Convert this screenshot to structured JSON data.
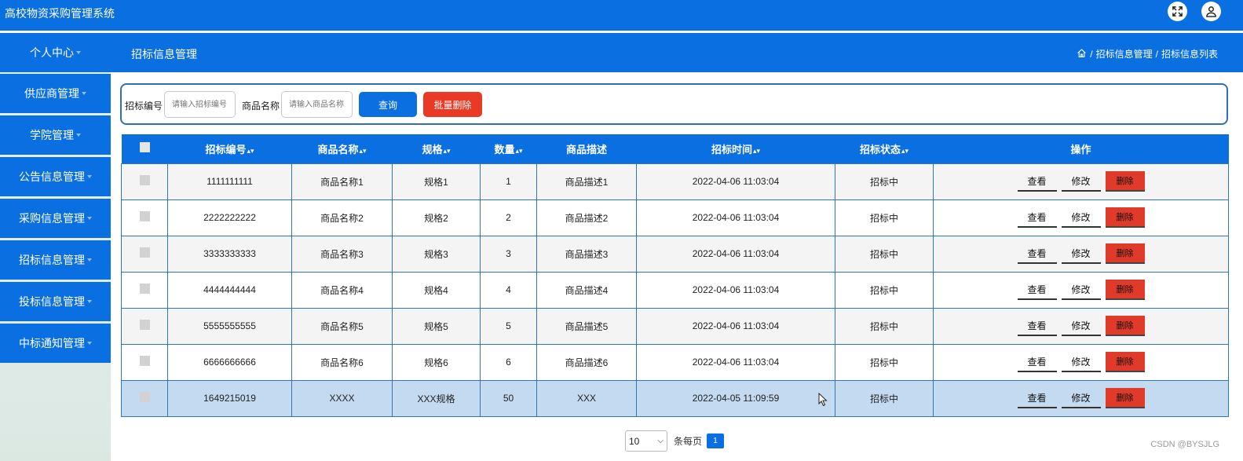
{
  "app": {
    "title": "高校物资采购管理系统"
  },
  "header": {
    "fullscreen_icon": "fullscreen-icon",
    "user_icon": "user-icon"
  },
  "sidebar": {
    "title": "个人中心",
    "items": [
      {
        "label": "供应商管理"
      },
      {
        "label": "学院管理"
      },
      {
        "label": "公告信息管理"
      },
      {
        "label": "采购信息管理"
      },
      {
        "label": "招标信息管理"
      },
      {
        "label": "投标信息管理"
      },
      {
        "label": "中标通知管理"
      }
    ]
  },
  "page": {
    "title": "招标信息管理",
    "breadcrumb": [
      "招标信息管理",
      "招标信息列表"
    ],
    "breadcrumb_sep": "/"
  },
  "search": {
    "bid_no_label": "招标编号",
    "bid_no_placeholder": "请输入招标编号",
    "product_label": "商品名称",
    "product_placeholder": "请输入商品名称",
    "query_button": "查询",
    "batch_delete_button": "批量删除"
  },
  "table": {
    "headers": [
      "招标编号",
      "商品名称",
      "规格",
      "数量",
      "商品描述",
      "招标时间",
      "招标状态",
      "操作"
    ],
    "sortable": [
      true,
      true,
      true,
      true,
      false,
      true,
      true,
      false
    ],
    "actions": {
      "view": "查看",
      "edit": "修改",
      "delete": "删除"
    },
    "rows": [
      [
        "1111111111",
        "商品名称1",
        "规格1",
        "1",
        "商品描述1",
        "2022-04-06 11:03:04",
        "招标中"
      ],
      [
        "2222222222",
        "商品名称2",
        "规格2",
        "2",
        "商品描述2",
        "2022-04-06 11:03:04",
        "招标中"
      ],
      [
        "3333333333",
        "商品名称3",
        "规格3",
        "3",
        "商品描述3",
        "2022-04-06 11:03:04",
        "招标中"
      ],
      [
        "4444444444",
        "商品名称4",
        "规格4",
        "4",
        "商品描述4",
        "2022-04-06 11:03:04",
        "招标中"
      ],
      [
        "5555555555",
        "商品名称5",
        "规格5",
        "5",
        "商品描述5",
        "2022-04-06 11:03:04",
        "招标中"
      ],
      [
        "6666666666",
        "商品名称6",
        "规格6",
        "6",
        "商品描述6",
        "2022-04-06 11:03:04",
        "招标中"
      ],
      [
        "1649215019",
        "XXXX",
        "XXX规格",
        "50",
        "XXX",
        "2022-04-05 11:09:59",
        "招标中"
      ]
    ]
  },
  "pagination": {
    "page_size": "10",
    "page_size_label": "条每页",
    "current_page": "1"
  },
  "watermark": "CSDN @BYSJLG",
  "colors": {
    "primary": "#0a6fe0",
    "danger": "#e83a24",
    "selected_row": "#c3daf0"
  }
}
